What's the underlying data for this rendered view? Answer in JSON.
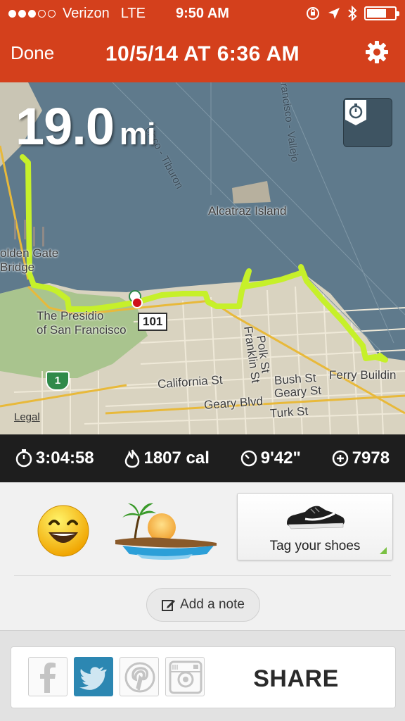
{
  "status_bar": {
    "carrier": "Verizon",
    "network": "LTE",
    "time": "9:50 AM",
    "signal_bars_filled": 3,
    "signal_bars_total": 5,
    "battery_level": 0.7
  },
  "header": {
    "done_label": "Done",
    "title": "10/5/14 AT 6:36 AM",
    "settings_icon": "gear-icon"
  },
  "run": {
    "distance_value": "19.0",
    "distance_unit": "mi",
    "route_color": "#c6f02a"
  },
  "map": {
    "labels": {
      "golden_gate": "olden Gate\nBridge",
      "alcatraz": "Alcatraz Island",
      "tiburon": "cisco - Tiburon",
      "vallejo": "rancisco - Vallejo",
      "presidio": "The Presidio\nof San Francisco",
      "hwy101": "101",
      "hwy1": "1",
      "california": "California St",
      "geary_blvd": "Geary Blvd",
      "geary_st": "Geary St",
      "bush": "Bush St",
      "turk": "Turk St",
      "franklin": "Franklin St",
      "polk": "Polk St",
      "ferry": "Ferry Buildin"
    },
    "legal_label": "Legal"
  },
  "stats": {
    "duration": "3:04:58",
    "calories": "1807 cal",
    "pace": "9'42\"",
    "fuel": "7978"
  },
  "tags": {
    "mood_icon": "smiley-face-icon",
    "terrain_icon": "beach-island-icon",
    "shoes_label": "Tag your shoes",
    "note_label": "Add a note"
  },
  "share": {
    "label": "SHARE",
    "services": [
      "facebook",
      "twitter",
      "pinterest",
      "instagram"
    ],
    "twitter_color": "#2c87b2"
  },
  "colors": {
    "accent": "#d4401c",
    "stats_bg": "#1e1e1e"
  }
}
